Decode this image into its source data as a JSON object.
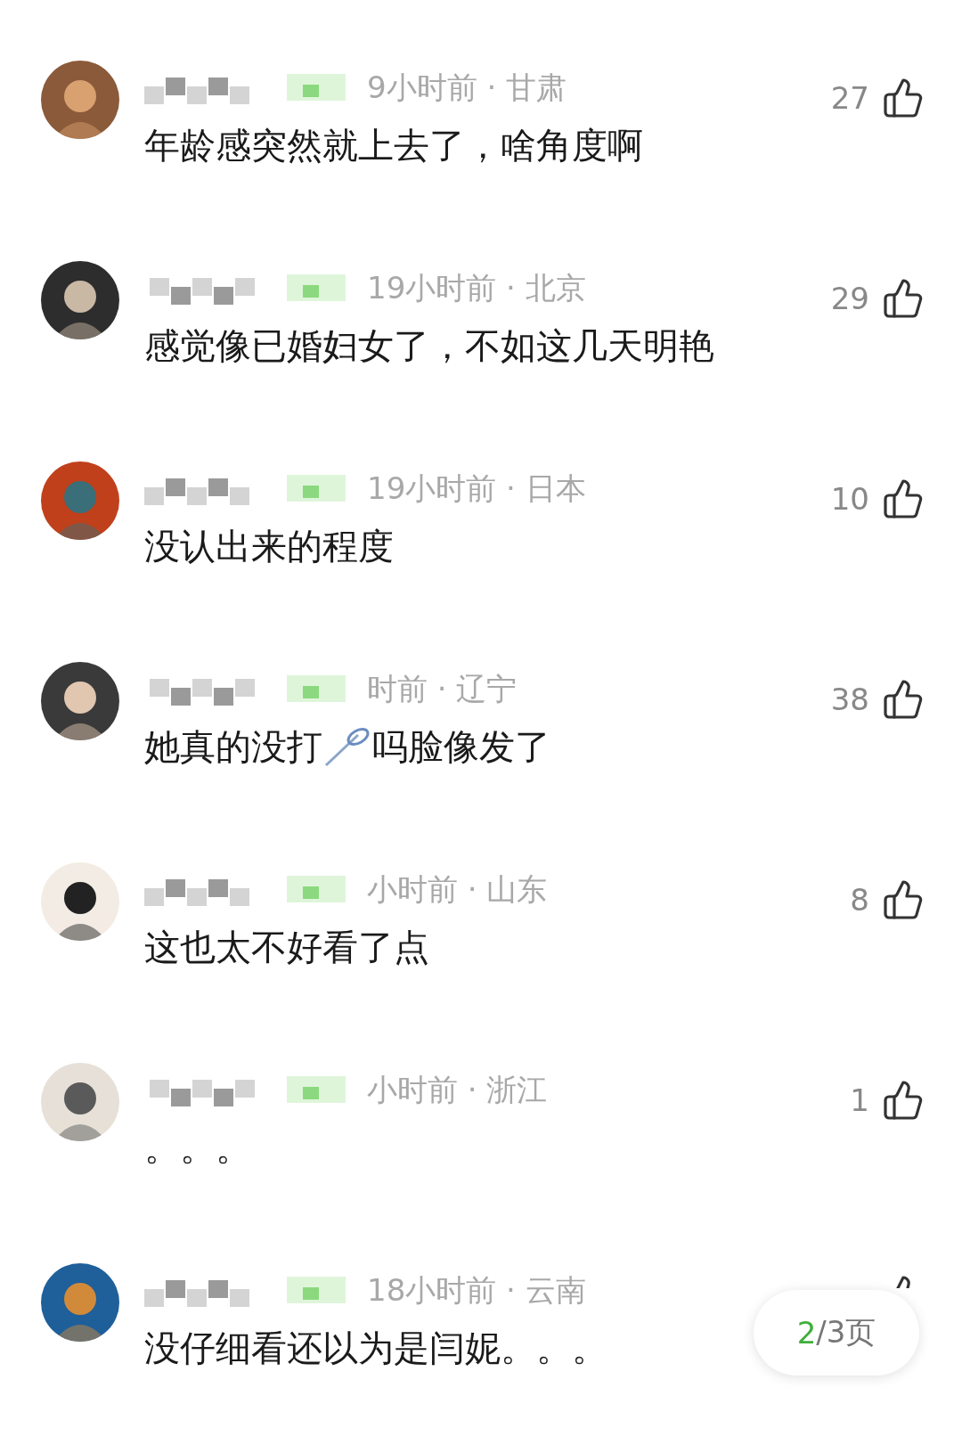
{
  "comments": [
    {
      "meta": "9小时前 · 甘肃",
      "likes": "27",
      "segments": [
        {
          "kind": "text",
          "text": "年龄感突然就上去了，啥角度啊"
        }
      ]
    },
    {
      "meta": "19小时前 · 北京",
      "likes": "29",
      "segments": [
        {
          "kind": "text",
          "text": "感觉像已婚妇女了，不如这几天明艳"
        }
      ]
    },
    {
      "meta": "19小时前 · 日本",
      "likes": "10",
      "segments": [
        {
          "kind": "text",
          "text": "没认出来的程度"
        }
      ]
    },
    {
      "meta": "时前 · 辽宁",
      "likes": "38",
      "segments": [
        {
          "kind": "text",
          "text": "她真的没打"
        },
        {
          "kind": "emoji"
        },
        {
          "kind": "text",
          "text": "吗脸像发了"
        }
      ]
    },
    {
      "meta": "小时前 · 山东",
      "likes": "8",
      "segments": [
        {
          "kind": "text",
          "text": "这也太不好看了点"
        }
      ]
    },
    {
      "meta": "小时前 · 浙江",
      "likes": "1",
      "segments": [
        {
          "kind": "text",
          "text": "。。。"
        }
      ]
    },
    {
      "meta": "18小时前 · 云南",
      "segments": [
        {
          "kind": "text",
          "text": "没仔细看还以为是闫妮。。。"
        }
      ]
    }
  ],
  "pager": {
    "current": "2",
    "rest": "/3页"
  }
}
